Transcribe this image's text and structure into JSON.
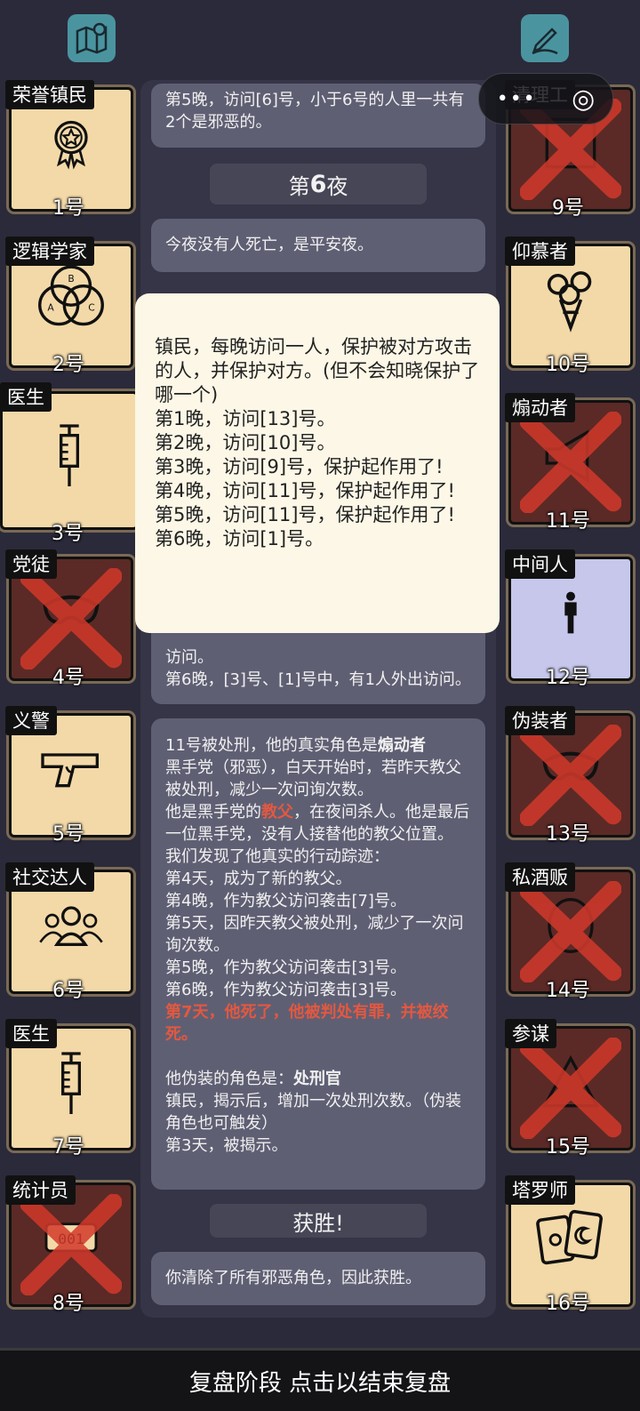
{
  "top": {
    "map_icon": "map-pin-icon",
    "edit_icon": "pen-icon"
  },
  "capsule": {
    "more": "•••",
    "close": "◎"
  },
  "left_roles": [
    {
      "role": "荣誉镇民",
      "num": "1号",
      "icon": "medal",
      "dead": false
    },
    {
      "role": "逻辑学家",
      "num": "2号",
      "icon": "venn",
      "dead": false
    },
    {
      "role": "医生",
      "num": "3号",
      "icon": "syringe",
      "dead": false
    },
    {
      "role": "党徒",
      "num": "4号",
      "icon": "mask",
      "dead": true
    },
    {
      "role": "义警",
      "num": "5号",
      "icon": "gun",
      "dead": false
    },
    {
      "role": "社交达人",
      "num": "6号",
      "icon": "people",
      "dead": false
    },
    {
      "role": "医生",
      "num": "7号",
      "icon": "syringe",
      "dead": false
    },
    {
      "role": "统计员",
      "num": "8号",
      "icon": "counter",
      "dead": true
    }
  ],
  "right_roles": [
    {
      "role": "清理工",
      "num": "9号",
      "icon": "machine",
      "dead": true
    },
    {
      "role": "仰慕者",
      "num": "10号",
      "icon": "flowers",
      "dead": false
    },
    {
      "role": "煽动者",
      "num": "11号",
      "icon": "megaphone",
      "dead": true
    },
    {
      "role": "中间人",
      "num": "12号",
      "icon": "person",
      "dead": false
    },
    {
      "role": "伪装者",
      "num": "13号",
      "icon": "mask",
      "dead": true
    },
    {
      "role": "私酒贩",
      "num": "14号",
      "icon": "barrel",
      "dead": true
    },
    {
      "role": "参谋",
      "num": "15号",
      "icon": "triangle",
      "dead": true
    },
    {
      "role": "塔罗师",
      "num": "16号",
      "icon": "tarot",
      "dead": false
    }
  ],
  "log": {
    "msg1": "第5晚，访问[6]号，小于6号的人里一共有2个是邪恶的。",
    "night_header": {
      "pre": "第",
      "num": "6",
      "post": "夜"
    },
    "msg2": "今夜没有人死亡，是平安夜。",
    "msg3": "访问。\n第6晚，[3]号、[1]号中，有1人外出访问。",
    "msg4": {
      "a1": "11号被处刑，他的真实角色是",
      "a_role": "煽动者",
      "a2": "黑手党（邪恶），白天开始时，若昨天教父被处刑，减少一次问询次数。",
      "b1": "他是黑手党的",
      "b_role": "教父",
      "b2": "，在夜间杀人。他是最后一位黑手党，没有人接替他的教父位置。",
      "c": "我们发现了他真实的行动踪迹：\n第4天，成为了新的教父。\n第4晚，作为教父访问袭击[7]号。\n第5天，因昨天教父被处刑，减少了一次问询次数。\n第5晚，作为教父访问袭击[3]号。\n第6晚，作为教父访问袭击[3]号。",
      "d": "第7天，他死了，他被判处有罪，并被绞死。",
      "e1": "他伪装的角色是：",
      "e_role": "处刑官",
      "e2": "镇民，揭示后，增加一次处刑次数。（伪装角色也可触发）\n第3天，被揭示。"
    },
    "win_header": "获胜!",
    "msg5": "你清除了所有邪恶角色，因此获胜。"
  },
  "popup": "镇民，每晚访问一人，保护被对方攻击的人，并保护对方。(但不会知晓保护了哪一个)\n第1晚，访问[13]号。\n第2晚，访问[10]号。\n第3晚，访问[9]号，保护起作用了!\n第4晚，访问[11]号，保护起作用了!\n第5晚，访问[11]号，保护起作用了!\n第6晚，访问[1]号。",
  "bottom_bar": "复盘阶段 点击以结束复盘"
}
